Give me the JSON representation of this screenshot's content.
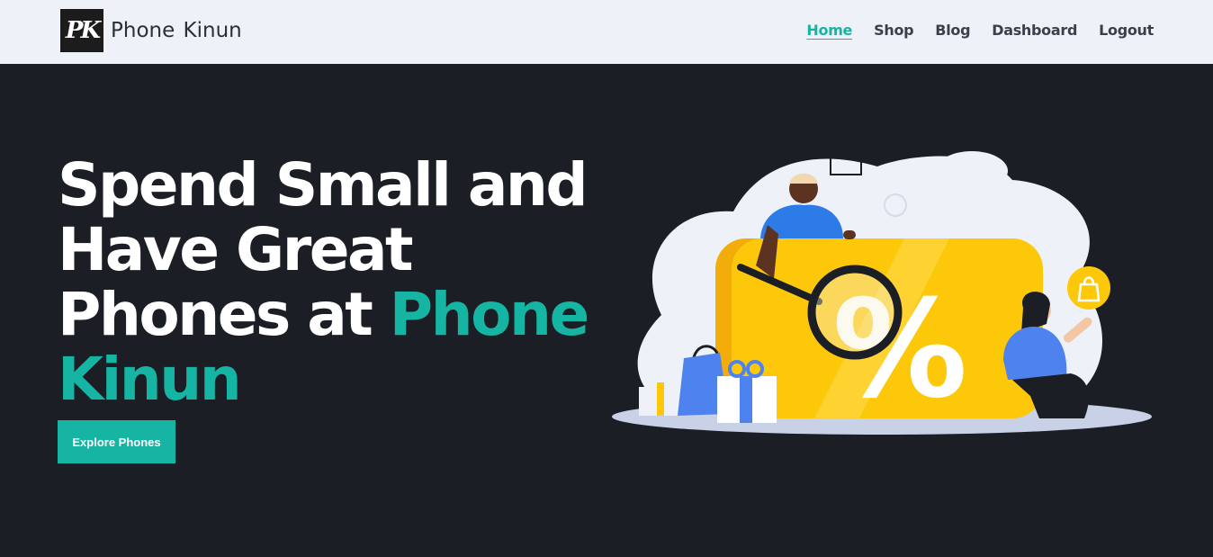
{
  "navbar": {
    "logo_text": "PK",
    "brand_name": "Phone Kinun",
    "links": [
      {
        "label": "Home",
        "active": true
      },
      {
        "label": "Shop"
      },
      {
        "label": "Blog"
      },
      {
        "label": "Dashboard"
      },
      {
        "label": "Logout"
      }
    ]
  },
  "hero": {
    "title_line1": "Spend Small and",
    "title_line2": "Have Great",
    "title_line3_prefix": "Phones at ",
    "title_accent_1": "Phone",
    "title_accent_2": "Kinun",
    "cta_label": "Explore Phones"
  },
  "illustration": {
    "discount_symbol": "%"
  },
  "colors": {
    "accent": "#16b4a3",
    "nav_bg": "#eef1f8",
    "hero_bg": "#1b1e25",
    "card_yellow": "#fdc80a"
  }
}
